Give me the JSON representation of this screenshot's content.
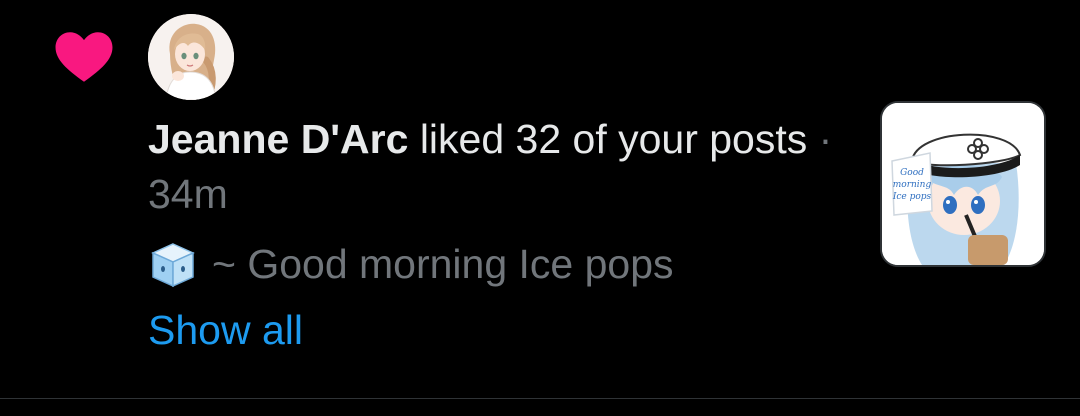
{
  "notification": {
    "type": "like",
    "actor_name": "Jeanne D'Arc",
    "action_text": " liked 32 of your posts",
    "separator": " · ",
    "time_ago": "34m",
    "preview_text": "~ Good morning Ice pops",
    "show_all_label": "Show all",
    "thumbnail_caption_lines": [
      "Good",
      "morning",
      "Ice pops"
    ]
  },
  "colors": {
    "background": "#000000",
    "heart": "#f91880",
    "primary_text": "#e7e9ea",
    "secondary_text": "#71767b",
    "link": "#1d9bf0",
    "divider": "#2f3336"
  },
  "icons": {
    "notification_type": "heart-icon",
    "preview_emoji": "ice-cube-icon"
  }
}
